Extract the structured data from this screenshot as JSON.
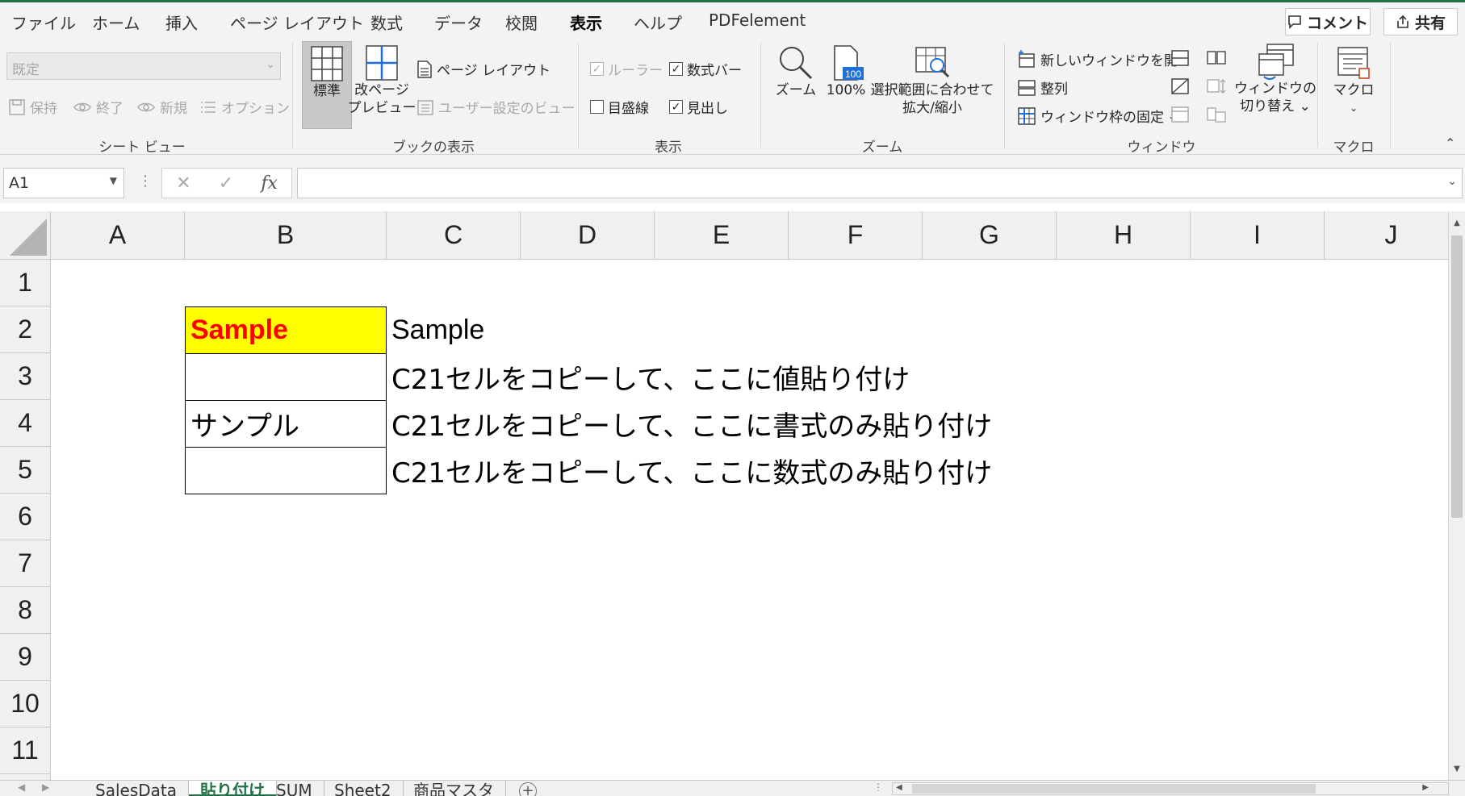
{
  "ribbon_tabs": [
    "ファイル",
    "ホーム",
    "挿入",
    "ページ レイアウト",
    "数式",
    "データ",
    "校閲",
    "表示",
    "ヘルプ",
    "PDFelement"
  ],
  "active_tab": "表示",
  "top_right": {
    "comment_label": "コメント",
    "share_label": "共有"
  },
  "sheet_view": {
    "dropdown_value": "既定",
    "keep_label": "保持",
    "exit_label": "終了",
    "new_label": "新規",
    "options_label": "オプション",
    "group_label": "シート ビュー"
  },
  "workbook_views": {
    "normal_label": "標準",
    "page_break_label_1": "改ページ",
    "page_break_label_2": "プレビュー",
    "page_layout_label": "ページ レイアウト",
    "custom_views_label": "ユーザー設定のビュー",
    "group_label": "ブックの表示"
  },
  "show": {
    "ruler_label": "ルーラー",
    "formula_bar_label": "数式バー",
    "gridlines_label": "目盛線",
    "headings_label": "見出し",
    "ruler_checked": true,
    "formula_bar_checked": true,
    "gridlines_checked": false,
    "headings_checked": true,
    "group_label": "表示"
  },
  "zoom": {
    "zoom_label": "ズーム",
    "hundred_label": "100%",
    "hundred_badge": "100",
    "selection_label_1": "選択範囲に合わせて",
    "selection_label_2": "拡大/縮小",
    "group_label": "ズーム"
  },
  "window": {
    "new_window_label": "新しいウィンドウを開く",
    "arrange_label": "整列",
    "freeze_label": "ウィンドウ枠の固定",
    "switch_label_1": "ウィンドウの",
    "switch_label_2": "切り替え",
    "group_label": "ウィンドウ"
  },
  "macros": {
    "macro_label": "マクロ",
    "group_label": "マクロ"
  },
  "formula_bar": {
    "name_box": "A1",
    "fx": "fx",
    "cancel": "✕",
    "enter": "✓",
    "content": ""
  },
  "columns": [
    "A",
    "B",
    "C",
    "D",
    "E",
    "F",
    "G",
    "H",
    "I",
    "J"
  ],
  "rows": [
    "1",
    "2",
    "3",
    "4",
    "5",
    "6",
    "7",
    "8",
    "9",
    "10",
    "11"
  ],
  "cells": {
    "B2": "Sample",
    "C2": "Sample",
    "C3": "C21セルをコピーして、ここに値貼り付け",
    "B4": "サンプル",
    "C4": "C21セルをコピーして、ここに書式のみ貼り付け",
    "C5": "C21セルをコピーして、ここに数式のみ貼り付け"
  },
  "colors": {
    "accent": "#217346",
    "highlight_fill": "#ffff00",
    "highlight_text": "#ff0000"
  },
  "sheet_tabs": [
    "SalesData",
    "貼り付け",
    "SUM",
    "Sheet2",
    "商品マスタ"
  ],
  "active_sheet": "貼り付け"
}
